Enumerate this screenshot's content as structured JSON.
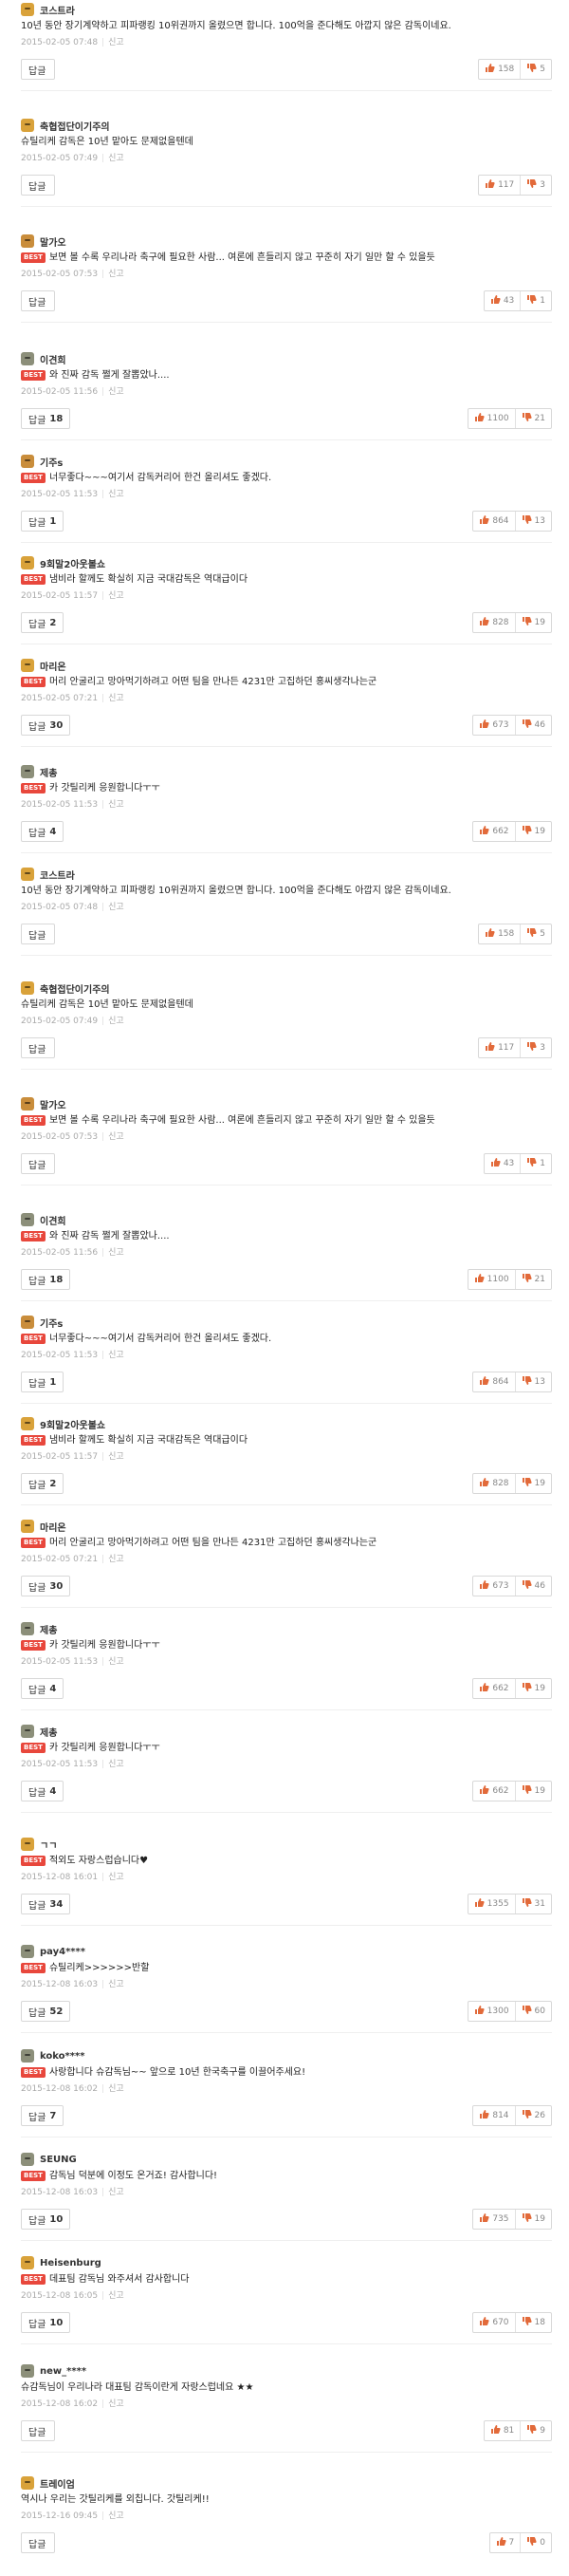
{
  "labels": {
    "reply": "답글",
    "report": "신고",
    "best_badge": "BEST"
  },
  "colors": {
    "best_badge": "#e8473c",
    "like_icon": "#e26a3a",
    "dislike_icon": "#e26a3a",
    "avatar_palette": [
      "#d9a23a",
      "#8c8f7a",
      "#c98d3b",
      "#7a8a6a"
    ]
  },
  "icons": {
    "like": "thumbs-up-icon",
    "dislike": "thumbs-down-icon",
    "avatar": "avatar-icon"
  },
  "comments": [
    {
      "nick": "코스트라",
      "best": false,
      "text": "10년 동안 장기계약하고 피파랭킹 10위권까지 올렸으면 합니다. 100억을 준다해도 아깝지 않은 감독이네요.",
      "date": "2015-02-05 07:48",
      "replies": "",
      "likes": "158",
      "dislikes": "5"
    },
    {
      "nick": "축협접단이기주의",
      "best": false,
      "text": "슈틸리케 감독은 10년 맡아도 문제없을텐데",
      "date": "2015-02-05 07:49",
      "replies": "",
      "likes": "117",
      "dislikes": "3"
    },
    {
      "nick": "말가오",
      "best": true,
      "text": "보면 볼 수록 우리나라 축구에 필요한 사람... 여론에 흔들리지 않고 꾸준히 자기 일만 할 수 있을듯",
      "date": "2015-02-05 07:53",
      "replies": "",
      "likes": "43",
      "dislikes": "1"
    },
    {
      "nick": "이견희",
      "best": true,
      "text": "와 진짜 감독 쩔게 잘뽑았나....",
      "date": "2015-02-05 11:56",
      "replies": "18",
      "likes": "1100",
      "dislikes": "21"
    },
    {
      "nick": "기주s",
      "best": true,
      "text": "너무좋다~~~여기서 감독커리어 한건 올리셔도 좋겠다.",
      "date": "2015-02-05 11:53",
      "replies": "1",
      "likes": "864",
      "dislikes": "13"
    },
    {
      "nick": "9회말2아웃볼쇼",
      "best": true,
      "text": "냄비라 할께도 확실히 지금 국대감독은 역대급이다",
      "date": "2015-02-05 11:57",
      "replies": "2",
      "likes": "828",
      "dislikes": "19"
    },
    {
      "nick": "마리온",
      "best": true,
      "text": "머리 안굴리고 망아먹기하려고 어떤 팀을 만나든 4231만 고집하던 홍씨생각나는군",
      "date": "2015-02-05 07:21",
      "replies": "30",
      "likes": "673",
      "dislikes": "46"
    },
    {
      "nick": "제총",
      "best": true,
      "text": "카 갓틸리케 응원합니다ㅜㅜ",
      "date": "2015-02-05 11:53",
      "replies": "4",
      "likes": "662",
      "dislikes": "19"
    },
    {
      "nick": "코스트라",
      "best": false,
      "text": "10년 동안 장기계약하고 피파랭킹 10위권까지 올렸으면 합니다. 100억을 준다해도 아깝지 않은 감독이네요.",
      "date": "2015-02-05 07:48",
      "replies": "",
      "likes": "158",
      "dislikes": "5"
    },
    {
      "nick": "축협접단이기주의",
      "best": false,
      "text": "슈틸리케 감독은 10년 맡아도 문제없을텐데",
      "date": "2015-02-05 07:49",
      "replies": "",
      "likes": "117",
      "dislikes": "3"
    },
    {
      "nick": "말가오",
      "best": true,
      "text": "보면 볼 수록 우리나라 축구에 필요한 사람... 여론에 흔들리지 않고 꾸준히 자기 일만 할 수 있을듯",
      "date": "2015-02-05 07:53",
      "replies": "",
      "likes": "43",
      "dislikes": "1"
    },
    {
      "nick": "이견희",
      "best": true,
      "text": "와 진짜 감독 쩔게 잘뽑았나....",
      "date": "2015-02-05 11:56",
      "replies": "18",
      "likes": "1100",
      "dislikes": "21"
    },
    {
      "nick": "기주s",
      "best": true,
      "text": "너무좋다~~~여기서 감독커리어 한건 올리셔도 좋겠다.",
      "date": "2015-02-05 11:53",
      "replies": "1",
      "likes": "864",
      "dislikes": "13"
    },
    {
      "nick": "9회말2아웃볼쇼",
      "best": true,
      "text": "냄비라 할께도 확실히 지금 국대감독은 역대급이다",
      "date": "2015-02-05 11:57",
      "replies": "2",
      "likes": "828",
      "dislikes": "19"
    },
    {
      "nick": "마리온",
      "best": true,
      "text": "머리 안굴리고 망아먹기하려고 어떤 팀을 만나든 4231만 고집하던 홍씨생각나는군",
      "date": "2015-02-05 07:21",
      "replies": "30",
      "likes": "673",
      "dislikes": "46"
    },
    {
      "nick": "제총",
      "best": true,
      "text": "카 갓틸리케 응원합니다ㅜㅜ",
      "date": "2015-02-05 11:53",
      "replies": "4",
      "likes": "662",
      "dislikes": "19"
    },
    {
      "nick": "제총",
      "best": true,
      "text": "카 갓틸리케 응원합니다ㅜㅜ",
      "date": "2015-02-05 11:53",
      "replies": "4",
      "likes": "662",
      "dislikes": "19"
    },
    {
      "nick": "ㄱㄱ",
      "best": true,
      "text": "적외도 자랑스럽습니다♥",
      "date": "2015-12-08 16:01",
      "replies": "34",
      "likes": "1355",
      "dislikes": "31"
    },
    {
      "nick": "pay4****",
      "best": true,
      "text": "슈틸리케>>>>>>반할",
      "date": "2015-12-08 16:03",
      "replies": "52",
      "likes": "1300",
      "dislikes": "60"
    },
    {
      "nick": "koko****",
      "best": true,
      "text": "사랑합니다 슈감독님~~ 앞으로 10년 한국축구를 이끌어주세요!",
      "date": "2015-12-08 16:02",
      "replies": "7",
      "likes": "814",
      "dislikes": "26"
    },
    {
      "nick": "SEUNG",
      "best": true,
      "text": "감독님 덕분에 이정도 온거죠! 감사합니다!",
      "date": "2015-12-08 16:03",
      "replies": "10",
      "likes": "735",
      "dislikes": "19"
    },
    {
      "nick": "Heisenburg",
      "best": true,
      "text": "데표팀 감독님 와주셔서 감사합니다",
      "date": "2015-12-08 16:05",
      "replies": "10",
      "likes": "670",
      "dislikes": "18"
    },
    {
      "nick": "new_****",
      "best": false,
      "text": "슈감독님이 우리나라 대표팀 감독이란게 자랑스럽네요 ★★",
      "date": "2015-12-08 16:02",
      "replies": "",
      "likes": "81",
      "dislikes": "9"
    },
    {
      "nick": "트레이엄",
      "best": false,
      "text": "역시나 우리는 갓틸리케를 외칩니다. 갓틸리케!!",
      "date": "2015-12-16 09:45",
      "replies": "",
      "likes": "7",
      "dislikes": "0"
    }
  ]
}
